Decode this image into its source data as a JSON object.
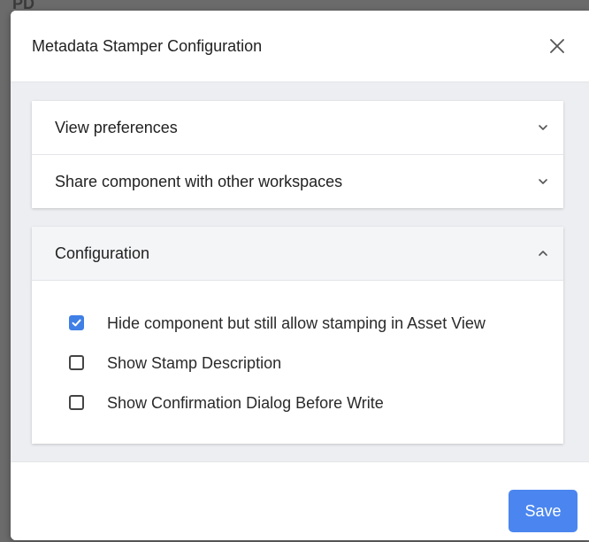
{
  "backdrop": {
    "peek_text": "PD"
  },
  "dialog": {
    "title": "Metadata Stamper Configuration",
    "close_icon": "close-icon"
  },
  "sections": {
    "view_preferences": {
      "label": "View preferences",
      "expanded": false,
      "icon": "chevron-down-icon"
    },
    "share_component": {
      "label": "Share component with other workspaces",
      "expanded": false,
      "icon": "chevron-down-icon"
    },
    "configuration": {
      "label": "Configuration",
      "expanded": true,
      "icon": "chevron-up-icon",
      "options": [
        {
          "label": "Hide component but still allow stamping in Asset View",
          "checked": true
        },
        {
          "label": "Show Stamp Description",
          "checked": false
        },
        {
          "label": "Show Confirmation Dialog Before Write",
          "checked": false
        }
      ]
    }
  },
  "footer": {
    "save_label": "Save"
  },
  "colors": {
    "accent": "#4b86f0",
    "checkbox_checked": "#3f7fe6",
    "body_background": "#eceef1"
  }
}
